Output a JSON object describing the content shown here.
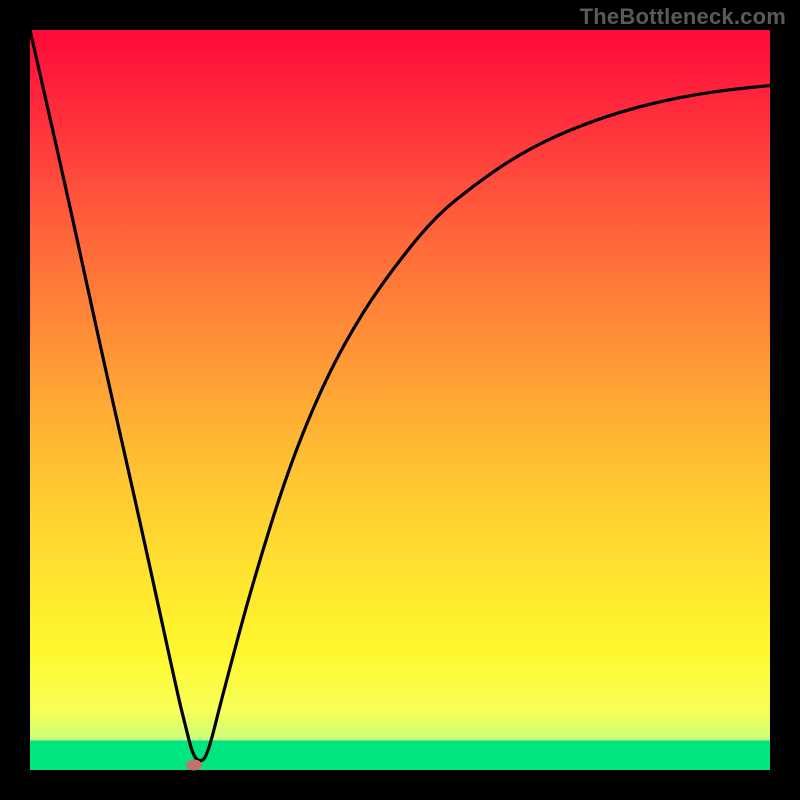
{
  "watermark": "TheBottleneck.com",
  "chart_data": {
    "type": "line",
    "title": "",
    "xlabel": "",
    "ylabel": "",
    "xlim": [
      0,
      100
    ],
    "ylim": [
      0,
      100
    ],
    "grid": false,
    "legend": false,
    "green_band": {
      "from": 0,
      "to": 4
    },
    "series": [
      {
        "name": "bottleneck-curve",
        "color": "#000000",
        "x": [
          0,
          5,
          10,
          15,
          20,
          21,
          22,
          23,
          24,
          26,
          30,
          35,
          40,
          45,
          50,
          55,
          60,
          65,
          70,
          75,
          80,
          85,
          90,
          95,
          100
        ],
        "y": [
          100,
          78,
          55,
          33,
          10,
          6,
          2,
          1,
          2,
          10,
          25,
          41,
          53,
          62,
          69,
          75,
          79,
          82.5,
          85.2,
          87.3,
          89,
          90.3,
          91.3,
          92,
          92.5
        ]
      }
    ],
    "dot": {
      "x": 22.2,
      "y": 0.7,
      "color": "#c17469"
    },
    "gradient_stops": [
      {
        "pct": 0,
        "color": "#ff0a3a"
      },
      {
        "pct": 12,
        "color": "#ff2f3c"
      },
      {
        "pct": 28,
        "color": "#ff663a"
      },
      {
        "pct": 44,
        "color": "#ff9636"
      },
      {
        "pct": 58,
        "color": "#ffbf33"
      },
      {
        "pct": 72,
        "color": "#ffe02f"
      },
      {
        "pct": 84,
        "color": "#fff82e"
      },
      {
        "pct": 92,
        "color": "#f7ff57"
      },
      {
        "pct": 96,
        "color": "#c8ff7a"
      },
      {
        "pct": 98,
        "color": "#7dffa0"
      },
      {
        "pct": 100,
        "color": "#00e580"
      }
    ]
  }
}
